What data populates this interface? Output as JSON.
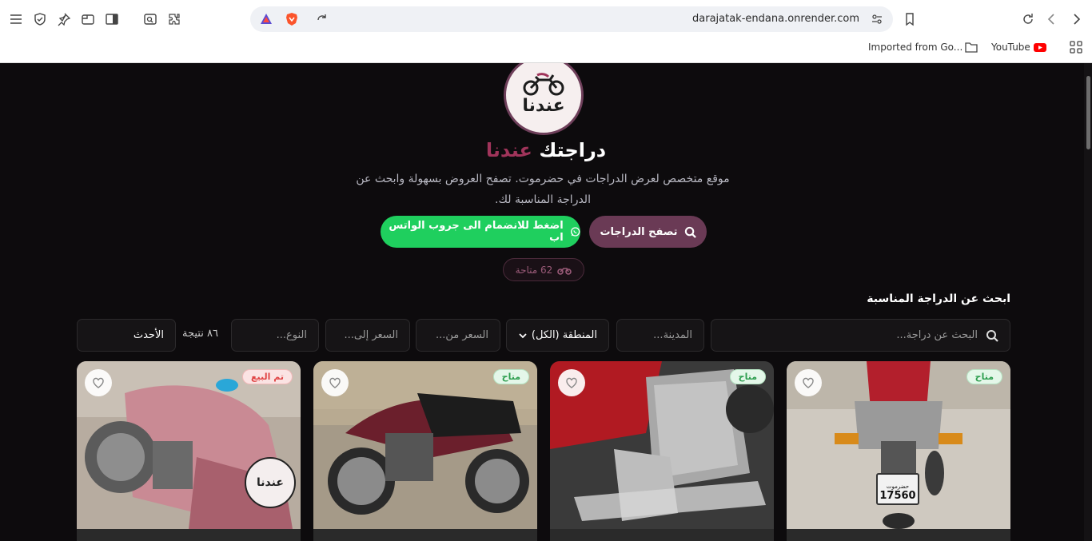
{
  "browser": {
    "url": "darajatak-endana.onrender.com",
    "bookmarks": [
      {
        "label": "Imported from Go..."
      },
      {
        "label": "YouTube"
      }
    ]
  },
  "hero": {
    "logo_text": "عندنا",
    "title_main": "دراجتك",
    "title_accent": "عندنا",
    "subtitle": "موقع متخصص لعرض الدراجات في حضرموت. تصفح العروض بسهولة وابحث عن الدراجة المناسبة لك.",
    "browse_button": "تصفح الدراجات",
    "whatsapp_button": "اضغط للانضمام الى جروب الواتس اب",
    "available_count": "62 متاحة"
  },
  "search": {
    "section_title": "ابحث عن الدراجة المناسبة",
    "search_placeholder": "البحث عن دراجة...",
    "city_placeholder": "المدينة...",
    "region_selected": "المنطقة (الكل)",
    "price_from_placeholder": "السعر من...",
    "price_to_placeholder": "السعر إلى...",
    "type_placeholder": "النوع...",
    "results_count": "٨٦ نتيجة",
    "sort_selected": "الأحدث"
  },
  "listings": [
    {
      "status": "تم البيع",
      "status_kind": "sold",
      "logo_text": "عندنا"
    },
    {
      "status": "متاح",
      "status_kind": "available"
    },
    {
      "status": "متاح",
      "status_kind": "available"
    },
    {
      "status": "متاح",
      "status_kind": "available",
      "plate_region": "حضرموت",
      "plate_number": "17560"
    }
  ],
  "colors": {
    "background": "#0d0b0d",
    "accent": "#a0345a",
    "browse_button": "#6a3a55",
    "whatsapp": "#1fcf5e"
  }
}
